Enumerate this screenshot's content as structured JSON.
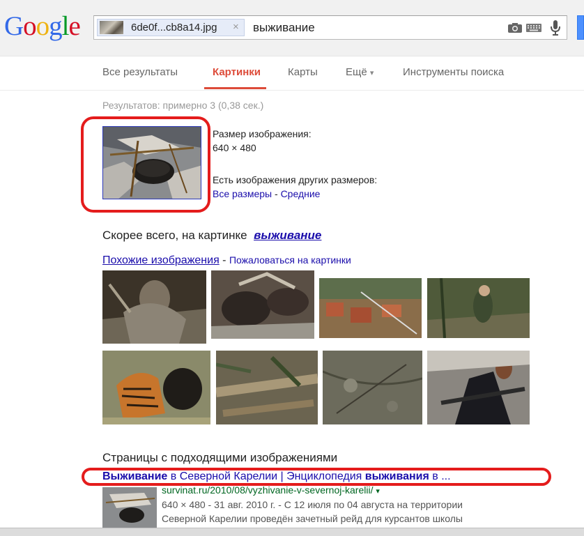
{
  "logo": {
    "text": "Google"
  },
  "search": {
    "image_chip_name": "6de0f...cb8a14.jpg",
    "image_chip_close": "×",
    "query": "выживание",
    "icons": [
      "camera-icon",
      "keyboard-icon",
      "mic-icon"
    ]
  },
  "nav": {
    "items": [
      "Все результаты",
      "Картинки",
      "Карты",
      "Ещё",
      "Инструменты поиска"
    ],
    "active": "Картинки",
    "more_arrow": "▾"
  },
  "stats": "Результатов: примерно 3 (0,38 сек.)",
  "image_info": {
    "size_label": "Размер изображения:",
    "size_value": "640 × 480",
    "other_sizes_label": "Есть изображения других размеров:",
    "all_sizes": "Все размеры",
    "separator": " - ",
    "medium": "Средние"
  },
  "best_guess": {
    "prefix": "Скорее всего, на картинке",
    "query": "выживание"
  },
  "similar": {
    "link": "Похожие изображения",
    "separator": " - ",
    "report": "Пожаловаться на картинки"
  },
  "pages": {
    "heading": "Страницы с подходящими изображениями",
    "results": [
      {
        "title_parts": [
          {
            "text": "Выживание",
            "bold": true
          },
          {
            "text": " в Северной Карелии | Энциклопедия ",
            "bold": false
          },
          {
            "text": "выживания",
            "bold": true
          },
          {
            "text": " в ...",
            "bold": false
          }
        ],
        "url": "survinat.ru/2010/08/vyzhivanie-v-severnoj-karelii/",
        "url_arrow": "▾",
        "snippet_lines": [
          "640 × 480 - 31 авг. 2010 г. - С 12 июля по 04 августа на территории",
          "Северной Карелии проведён зачетный рейд для курсантов школы"
        ]
      }
    ]
  },
  "colors": {
    "link": "#1a0dab",
    "accent": "#dd4b39",
    "url_green": "#006621",
    "annotation_red": "#e41c1c",
    "logo_blue": "#3369e8",
    "logo_red": "#d50f25",
    "logo_yellow": "#eeb211",
    "logo_green": "#009925"
  }
}
